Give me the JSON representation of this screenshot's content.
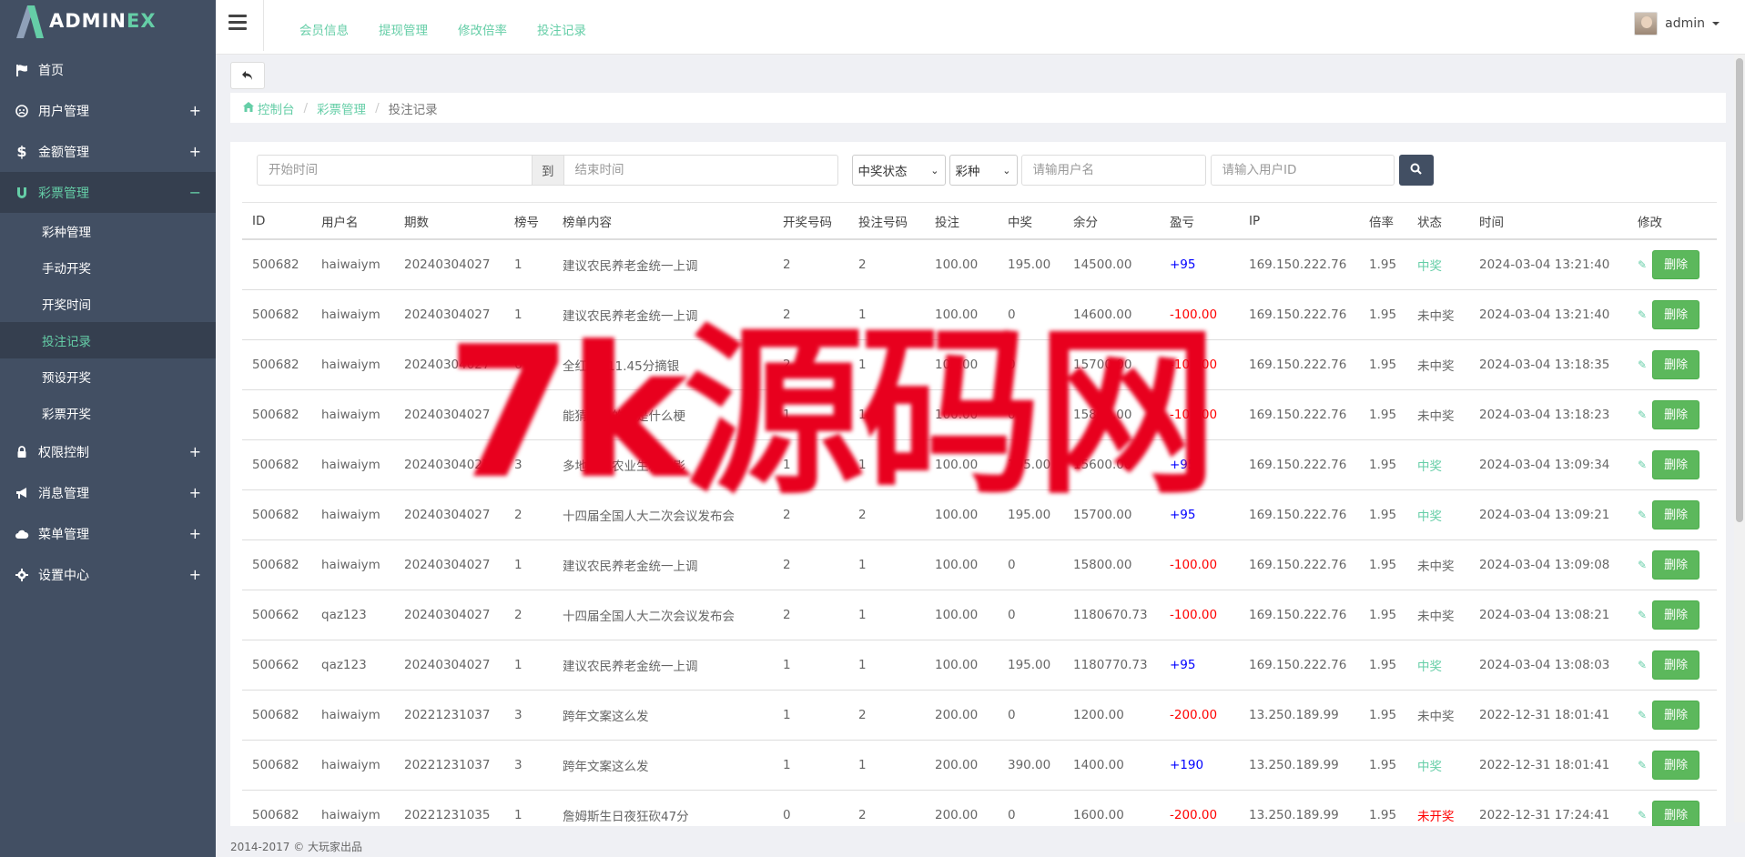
{
  "logo": {
    "prefix": "ADMIN",
    "suffix": "EX"
  },
  "sidebar": {
    "items": [
      {
        "label": "首页",
        "icon": "flag-icon",
        "expand": ""
      },
      {
        "label": "用户管理",
        "icon": "user-icon",
        "expand": "+"
      },
      {
        "label": "金额管理",
        "icon": "dollar-icon",
        "expand": "+"
      },
      {
        "label": "彩票管理",
        "icon": "magnet-icon",
        "expand": "−"
      },
      {
        "label": "权限控制",
        "icon": "lock-icon",
        "expand": "+"
      },
      {
        "label": "消息管理",
        "icon": "bullhorn-icon",
        "expand": "+"
      },
      {
        "label": "菜单管理",
        "icon": "cloud-icon",
        "expand": "+"
      },
      {
        "label": "设置中心",
        "icon": "gear-icon",
        "expand": "+"
      }
    ],
    "subitems": [
      "彩种管理",
      "手动开奖",
      "开奖时间",
      "投注记录",
      "预设开奖",
      "彩票开奖"
    ]
  },
  "topnav": [
    "会员信息",
    "提现管理",
    "修改倍率",
    "投注记录"
  ],
  "user": {
    "name": "admin"
  },
  "breadcrumb": {
    "home": "控制台",
    "parent": "彩票管理",
    "current": "投注记录"
  },
  "filter": {
    "start_placeholder": "开始时间",
    "to_label": "到",
    "end_placeholder": "结束时间",
    "status_select": "中奖状态",
    "lottery_select": "彩种",
    "username_placeholder": "请输用户名",
    "userid_placeholder": "请输入用户ID"
  },
  "table": {
    "headers": [
      "ID",
      "用户名",
      "期数",
      "榜号",
      "榜单内容",
      "开奖号码",
      "投注号码",
      "投注",
      "中奖",
      "余分",
      "盈亏",
      "IP",
      "倍率",
      "状态",
      "时间",
      "修改"
    ],
    "delete_label": "删除",
    "rows": [
      [
        "500682",
        "haiwaiym",
        "20240304027",
        "1",
        "建议农民养老金统一上调",
        "2",
        "2",
        "100.00",
        "195.00",
        "14500.00",
        "+95",
        "169.150.222.76",
        "1.95",
        "中奖",
        "2024-03-04 13:21:40"
      ],
      [
        "500682",
        "haiwaiym",
        "20240304027",
        "1",
        "建议农民养老金统一上调",
        "2",
        "1",
        "100.00",
        "0",
        "14600.00",
        "-100.00",
        "169.150.222.76",
        "1.95",
        "未中奖",
        "2024-03-04 13:21:40"
      ],
      [
        "500682",
        "haiwaiym",
        "20240304027",
        "6",
        "全红婵411.45分摘银",
        "2",
        "1",
        "100.00",
        "0",
        "15700.00",
        "-100.00",
        "169.150.222.76",
        "1.95",
        "未中奖",
        "2024-03-04 13:18:35"
      ],
      [
        "500682",
        "haiwaiym",
        "20240304027",
        "4",
        "能猜昨天的梗是什么梗",
        "1",
        "1",
        "100.00",
        "0",
        "15800.00",
        "-100.00",
        "169.150.222.76",
        "1.95",
        "未中奖",
        "2024-03-04 13:18:23"
      ],
      [
        "500682",
        "haiwaiym",
        "20240304027",
        "3",
        "多地出现农业生积极影",
        "1",
        "1",
        "100.00",
        "195.00",
        "15600.00",
        "+95",
        "169.150.222.76",
        "1.95",
        "中奖",
        "2024-03-04 13:09:34"
      ],
      [
        "500682",
        "haiwaiym",
        "20240304027",
        "2",
        "十四届全国人大二次会议发布会",
        "2",
        "2",
        "100.00",
        "195.00",
        "15700.00",
        "+95",
        "169.150.222.76",
        "1.95",
        "中奖",
        "2024-03-04 13:09:21"
      ],
      [
        "500682",
        "haiwaiym",
        "20240304027",
        "1",
        "建议农民养老金统一上调",
        "2",
        "1",
        "100.00",
        "0",
        "15800.00",
        "-100.00",
        "169.150.222.76",
        "1.95",
        "未中奖",
        "2024-03-04 13:09:08"
      ],
      [
        "500662",
        "qaz123",
        "20240304027",
        "2",
        "十四届全国人大二次会议发布会",
        "2",
        "1",
        "100.00",
        "0",
        "1180670.73",
        "-100.00",
        "169.150.222.76",
        "1.95",
        "未中奖",
        "2024-03-04 13:08:21"
      ],
      [
        "500662",
        "qaz123",
        "20240304027",
        "1",
        "建议农民养老金统一上调",
        "1",
        "1",
        "100.00",
        "195.00",
        "1180770.73",
        "+95",
        "169.150.222.76",
        "1.95",
        "中奖",
        "2024-03-04 13:08:03"
      ],
      [
        "500682",
        "haiwaiym",
        "20221231037",
        "3",
        "跨年文案这么发",
        "1",
        "2",
        "200.00",
        "0",
        "1200.00",
        "-200.00",
        "13.250.189.99",
        "1.95",
        "未中奖",
        "2022-12-31 18:01:41"
      ],
      [
        "500682",
        "haiwaiym",
        "20221231037",
        "3",
        "跨年文案这么发",
        "1",
        "1",
        "200.00",
        "390.00",
        "1400.00",
        "+190",
        "13.250.189.99",
        "1.95",
        "中奖",
        "2022-12-31 18:01:41"
      ],
      [
        "500682",
        "haiwaiym",
        "20221231035",
        "1",
        "詹姆斯生日夜狂砍47分",
        "0",
        "2",
        "200.00",
        "0",
        "1600.00",
        "-200.00",
        "13.250.189.99",
        "1.95",
        "未开奖",
        "2022-12-31 17:24:41"
      ]
    ]
  },
  "footer": "2014-2017 © 大玩家出品",
  "watermark": "7k源码网",
  "colors": {
    "accent": "#65cea7",
    "sidebar": "#424f63",
    "profit": "#0000ff",
    "loss": "#ff0000",
    "delete": "#5cb85c"
  }
}
